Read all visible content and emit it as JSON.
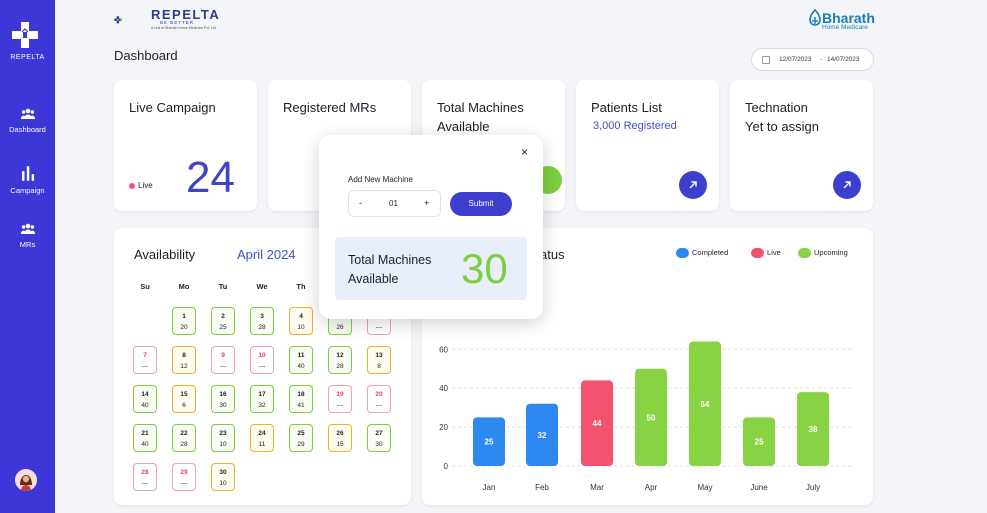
{
  "sidebar": {
    "brand": "REPELTA",
    "items": [
      {
        "label": "Dashboard",
        "icon": "users-icon"
      },
      {
        "label": "Campaign",
        "icon": "bar-chart-icon"
      },
      {
        "label": "MRs",
        "icon": "group-icon"
      }
    ]
  },
  "header": {
    "logo_text": "REPELTA",
    "logo_tagline": "BE BETTER",
    "logo_sub": "A Unit of Bharath Home Medicare Pvt. Ltd.",
    "partner_name": "Bharath",
    "partner_sub": "Home Medicare",
    "page_title": "Dashboard",
    "date_from": "12/07/2023",
    "date_sep": "-",
    "date_to": "14/07/2023"
  },
  "cards": {
    "live_campaign": {
      "title": "Live Campaign",
      "status": "Live",
      "value": "24"
    },
    "registered_mrs": {
      "title": "Registered MRs"
    },
    "total_machines": {
      "title_1": "Total Machines",
      "title_2": "Available"
    },
    "patients_list": {
      "title": "Patients List",
      "sub": "3,000 Registered"
    },
    "technation": {
      "title_1": "Technation",
      "title_2": "Yet to assign"
    }
  },
  "availability": {
    "title": "Availability",
    "month": "April 2024",
    "weekdays": [
      "Su",
      "Mo",
      "Tu",
      "We",
      "Th",
      "Fr",
      "Sa"
    ],
    "days": [
      {
        "d": "1",
        "v": "20",
        "s": "green"
      },
      {
        "d": "2",
        "v": "25",
        "s": "green"
      },
      {
        "d": "3",
        "v": "28",
        "s": "green"
      },
      {
        "d": "4",
        "v": "10",
        "s": "orange"
      },
      {
        "d": "5",
        "v": "26",
        "s": "green"
      },
      {
        "d": "6",
        "v": "---",
        "s": "red"
      },
      {
        "d": "7",
        "v": "---",
        "s": "red"
      },
      {
        "d": "8",
        "v": "12",
        "s": "orange"
      },
      {
        "d": "9",
        "v": "---",
        "s": "red"
      },
      {
        "d": "10",
        "v": "---",
        "s": "red"
      },
      {
        "d": "11",
        "v": "40",
        "s": "green"
      },
      {
        "d": "12",
        "v": "28",
        "s": "green"
      },
      {
        "d": "13",
        "v": "8",
        "s": "orange"
      },
      {
        "d": "14",
        "v": "40",
        "s": "green"
      },
      {
        "d": "15",
        "v": "6",
        "s": "orange"
      },
      {
        "d": "16",
        "v": "30",
        "s": "green"
      },
      {
        "d": "17",
        "v": "32",
        "s": "green"
      },
      {
        "d": "18",
        "v": "41",
        "s": "green"
      },
      {
        "d": "19",
        "v": "---",
        "s": "red"
      },
      {
        "d": "20",
        "v": "---",
        "s": "red"
      },
      {
        "d": "21",
        "v": "40",
        "s": "green"
      },
      {
        "d": "22",
        "v": "28",
        "s": "green"
      },
      {
        "d": "23",
        "v": "10",
        "s": "green"
      },
      {
        "d": "24",
        "v": "11",
        "s": "orange"
      },
      {
        "d": "25",
        "v": "29",
        "s": "green"
      },
      {
        "d": "26",
        "v": "15",
        "s": "orange"
      },
      {
        "d": "27",
        "v": "30",
        "s": "green"
      },
      {
        "d": "28",
        "v": "---",
        "s": "red"
      },
      {
        "d": "29",
        "v": "---",
        "s": "red"
      },
      {
        "d": "30",
        "v": "10",
        "s": "orange"
      }
    ]
  },
  "chart_data": {
    "type": "bar",
    "title": "atus",
    "categories": [
      "Jan",
      "Feb",
      "Mar",
      "Apr",
      "May",
      "June",
      "July"
    ],
    "values": [
      25,
      32,
      44,
      50,
      64,
      25,
      38
    ],
    "status": [
      "Completed",
      "Completed",
      "Live",
      "Upcoming",
      "Upcoming",
      "Upcoming",
      "Upcoming"
    ],
    "yticks": [
      "0",
      "20",
      "40",
      "60"
    ],
    "ylim": [
      0,
      70
    ],
    "legend": [
      {
        "name": "Completed",
        "color": "#2d88f0"
      },
      {
        "name": "Live",
        "color": "#f4536e"
      },
      {
        "name": "Upcoming",
        "color": "#88d343"
      }
    ],
    "legend_position": "top-right",
    "grid": true
  },
  "modal": {
    "label": "Add New Machine",
    "minus": "-",
    "quantity": "01",
    "plus": "+",
    "submit": "Submit",
    "close": "×",
    "tm_title_1": "Total Machines",
    "tm_title_2": "Available",
    "tm_value": "30"
  },
  "colors": {
    "primary": "#3e37d8",
    "completed": "#2d88f0",
    "live": "#f4536e",
    "upcoming": "#88d343"
  }
}
